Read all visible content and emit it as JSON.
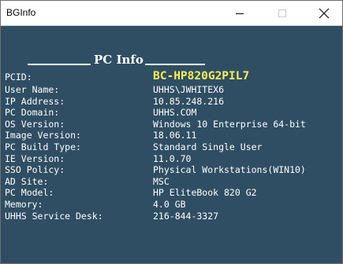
{
  "window": {
    "title": "BGInfo"
  },
  "heading": {
    "text": "PC Info"
  },
  "info_rows": [
    {
      "label": "PCID:",
      "value": "BC-HP820G2PIL7"
    },
    {
      "label": "User Name:",
      "value": "UHHS\\JWHITEX6"
    },
    {
      "label": "IP Address:",
      "value": "10.85.248.216"
    },
    {
      "label": "PC Domain:",
      "value": "UHHS.COM"
    },
    {
      "label": "OS Version:",
      "value": "Windows 10 Enterprise 64-bit"
    },
    {
      "label": "Image Version:",
      "value": "18.06.11"
    },
    {
      "label": "PC Build Type:",
      "value": "Standard Single User"
    },
    {
      "label": "IE Version:",
      "value": "11.0.70"
    },
    {
      "label": "SSO Policy:",
      "value": "Physical Workstations(WIN10)"
    },
    {
      "label": "AD Site:",
      "value": "MSC"
    },
    {
      "label": "PC Model:",
      "value": "HP EliteBook 820 G2"
    },
    {
      "label": "Memory:",
      "value": "4.0 GB"
    },
    {
      "label": "UHHS Service Desk:",
      "value": "216-844-3327"
    }
  ],
  "icons": {
    "minimize": "minimize-icon",
    "maximize": "maximize-icon",
    "close": "close-icon"
  },
  "colors": {
    "background": "#2f4e63",
    "text": "#ffffff",
    "highlight": "#f8ef58"
  }
}
